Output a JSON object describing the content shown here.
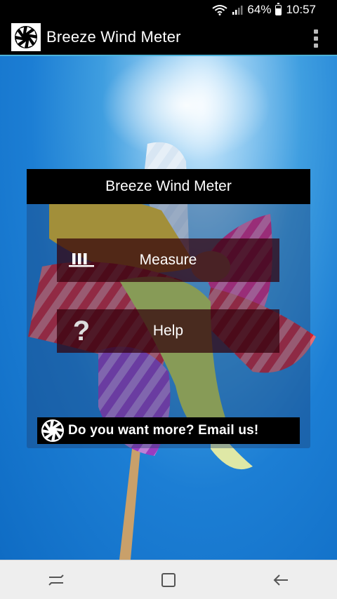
{
  "status_bar": {
    "battery": "64%",
    "time": "10:57",
    "wifi_icon": "wifi-icon",
    "signal_icon": "signal-icon",
    "battery_icon": "battery-icon"
  },
  "app_bar": {
    "title": "Breeze Wind Meter",
    "logo_icon": "aperture-logo-icon",
    "menu_icon": "overflow-menu-icon"
  },
  "card": {
    "title": "Breeze Wind Meter",
    "buttons": [
      {
        "label": "Measure",
        "icon": "meter-bars-icon"
      },
      {
        "label": "Help",
        "icon": "question-icon"
      }
    ],
    "help_glyph": "?",
    "email_banner": {
      "text": "Do you want more? Email us!",
      "icon": "aperture-logo-icon"
    }
  },
  "nav_bar": {
    "items": [
      "recents-icon",
      "home-icon",
      "back-icon"
    ]
  },
  "colors": {
    "accent_line": "#4cb2d8",
    "sky": "#1c7ed4",
    "button_bg": "#320008",
    "header_bg": "#000000"
  }
}
